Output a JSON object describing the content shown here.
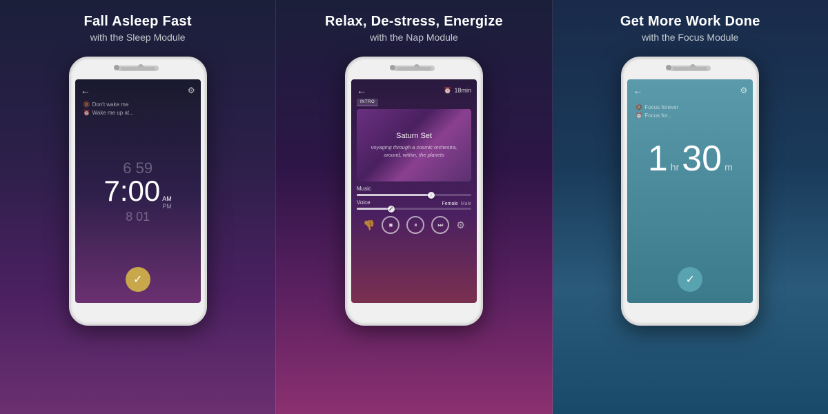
{
  "panels": [
    {
      "id": "sleep",
      "title": "Fall Asleep Fast",
      "subtitle": "with the Sleep Module",
      "screen": {
        "wake_option_1": "Don't wake me",
        "wake_option_2": "Wake me up at...",
        "time_prev": "6  59",
        "time_main": "7:00",
        "time_am": "AM",
        "time_pm": "PM",
        "time_next": "8  01"
      }
    },
    {
      "id": "nap",
      "title": "Relax, De-stress, Energize",
      "subtitle": "with the Nap Module",
      "screen": {
        "timer": "18min",
        "badge": "INTRO",
        "album_title": "Saturn Set",
        "album_desc": "voyaging through a cosmic orchestra, around, within, the planets",
        "music_label": "Music",
        "voice_label": "Voice",
        "voice_female": "Female",
        "voice_male": "Male"
      }
    },
    {
      "id": "focus",
      "title": "Get More Work Done",
      "subtitle": "with the Focus Module",
      "screen": {
        "focus_option_1": "Focus forever",
        "focus_option_2": "Focus for...",
        "time_hr": "1",
        "time_unit_hr": "hr",
        "time_min": "30",
        "time_unit_min": "m"
      }
    }
  ]
}
